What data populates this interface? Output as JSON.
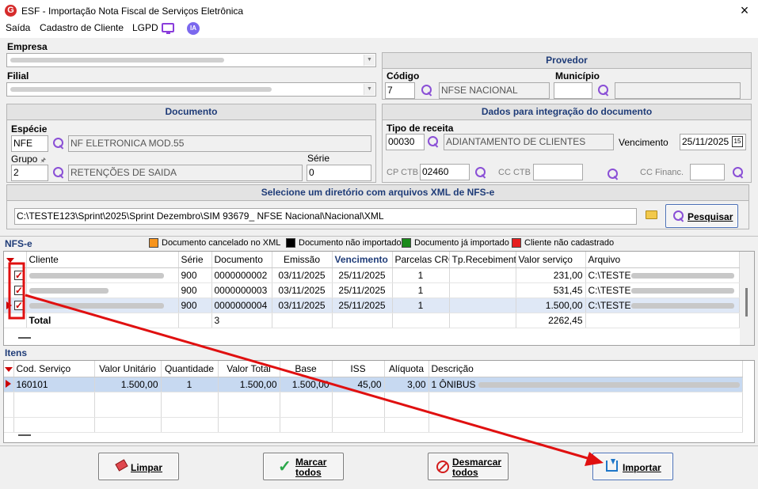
{
  "window": {
    "title": "ESF - Importação Nota Fiscal de Serviços Eletrônica",
    "logo": "G"
  },
  "menu": {
    "items": [
      "Saída",
      "Cadastro de Cliente",
      "LGPD"
    ],
    "ia_label": "IA"
  },
  "empresa": {
    "label": "Empresa",
    "value_blurred": true
  },
  "filial": {
    "label": "Filial",
    "value_blurred": true
  },
  "provedor": {
    "title": "Provedor",
    "codigo_label": "Código",
    "codigo": "7",
    "descricao": "NFSE NACIONAL",
    "municipio_label": "Município",
    "municipio": "",
    "municipio_desc": ""
  },
  "documento": {
    "title": "Documento",
    "especie_label": "Espécie",
    "especie": "NFE",
    "especie_desc": "NF ELETRONICA MOD.55",
    "grupo_label": "Grupo",
    "grupo": "2",
    "grupo_desc": "RETENÇÕES DE SAIDA",
    "serie_label": "Série",
    "serie": "0"
  },
  "integracao": {
    "title": "Dados para integração do documento",
    "tipo_receita_label": "Tipo de receita",
    "tipo_receita": "00030",
    "tipo_receita_desc": "ADIANTAMENTO DE CLIENTES",
    "vencimento_label": "Vencimento",
    "vencimento": "25/11/2025",
    "cp_ctb_label": "CP CTB",
    "cp_ctb": "02460",
    "cc_ctb_label": "CC CTB",
    "cc_ctb": "",
    "cc_financ_label": "CC Financ.",
    "cc_financ": ""
  },
  "diretorio": {
    "title": "Selecione um diretório com arquivos XML de NFS-e",
    "path": "C:\\TESTE123\\Sprint\\2025\\Sprint Dezembro\\SIM 93679_ NFSE Nacional\\Nacional\\XML",
    "pesquisar_label": "Pesquisar"
  },
  "nfse": {
    "title": "NFS-e",
    "legend": [
      {
        "label": "Documento cancelado no XML",
        "color": "#f7941d"
      },
      {
        "label": "Documento não importado",
        "color": "#000000"
      },
      {
        "label": "Documento já importado",
        "color": "#1a8a1a"
      },
      {
        "label": "Cliente não cadastrado",
        "color": "#e61e1e"
      }
    ],
    "columns": [
      "Cliente",
      "Série",
      "Documento",
      "Emissão",
      "Vencimento",
      "Parcelas CRC",
      "Tp.Recebimento",
      "Valor serviço",
      "Arquivo"
    ],
    "rows": [
      {
        "serie": "900",
        "documento": "0000000002",
        "emissao": "03/11/2025",
        "vencimento": "25/11/2025",
        "parcelas": "1",
        "tp": "",
        "valor": "231,00",
        "arquivo": "C:\\TESTE"
      },
      {
        "serie": "900",
        "documento": "0000000003",
        "emissao": "03/11/2025",
        "vencimento": "25/11/2025",
        "parcelas": "1",
        "tp": "",
        "valor": "531,45",
        "arquivo": "C:\\TESTE"
      },
      {
        "serie": "900",
        "documento": "0000000004",
        "emissao": "03/11/2025",
        "vencimento": "25/11/2025",
        "parcelas": "1",
        "tp": "",
        "valor": "1.500,00",
        "arquivo": "C:\\TESTE"
      }
    ],
    "total_label": "Total",
    "total_documentos": "3",
    "total_valor": "2262,45"
  },
  "itens": {
    "title": "Itens",
    "columns": [
      "Cod. Serviço",
      "Valor Unitário",
      "Quantidade",
      "Valor Total",
      "Base",
      "ISS",
      "Alíquota",
      "Descrição"
    ],
    "rows": [
      {
        "cod": "160101",
        "unit": "1.500,00",
        "qtd": "1",
        "total": "1.500,00",
        "base": "1.500,00",
        "iss": "45,00",
        "aliquota": "3,00",
        "descricao": "1 ÔNIBUS"
      }
    ]
  },
  "buttons": {
    "limpar": "Limpar",
    "marcar_todos": [
      "Marcar",
      "todos"
    ],
    "desmarcar_todos": [
      "Desmarcar",
      "todos"
    ],
    "importar": "Importar"
  },
  "colors": {
    "header_text": "#1f3c78",
    "annotation": "#e01010",
    "selection": "#c7d9f1"
  }
}
